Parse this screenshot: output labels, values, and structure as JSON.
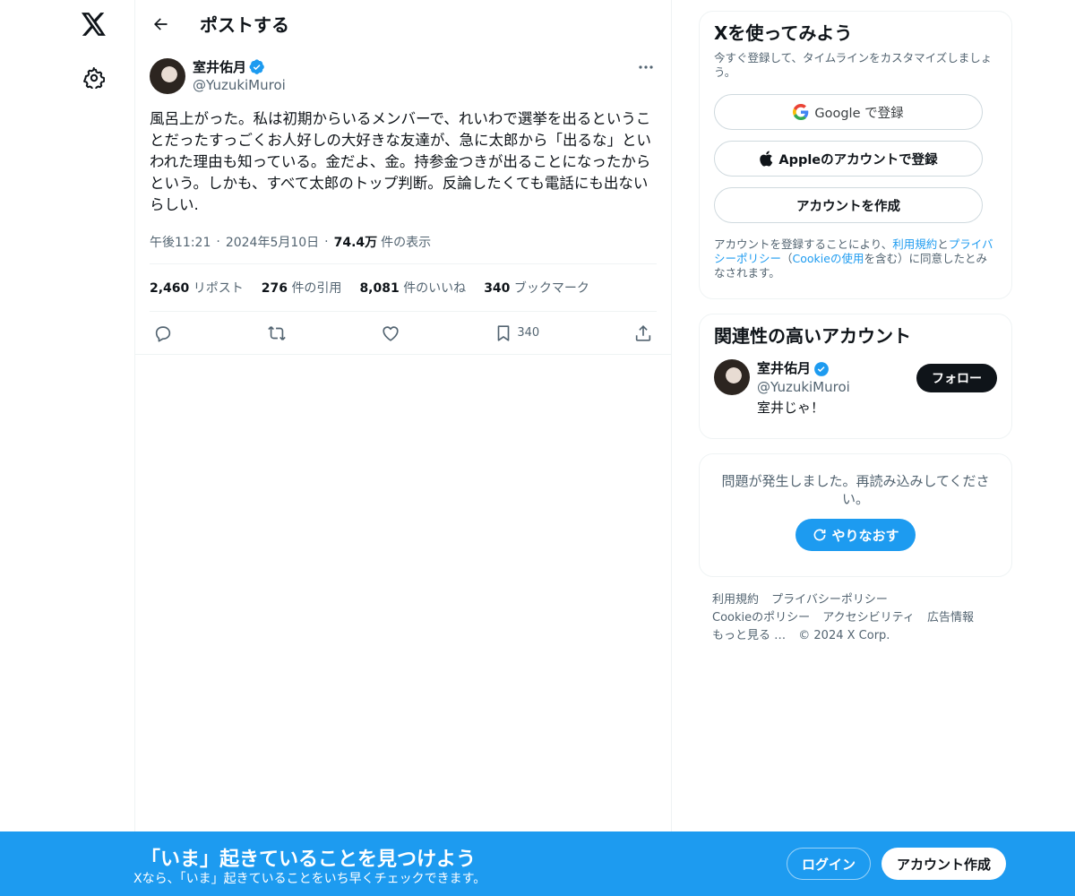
{
  "nav": {
    "logo_icon": "x-logo-icon",
    "settings_icon": "gear-icon"
  },
  "header": {
    "title": "ポストする"
  },
  "post": {
    "author_name": "室井佑月",
    "handle": "@YuzukiMuroi",
    "text": "風呂上がった。私は初期からいるメンバーで、れいわで選挙を出るということだったすっごくお人好しの大好きな友達が、急に太郎から「出るな」といわれた理由も知っている。金だよ、金。持参金つきが出ることになったからという。しかも、すべて太郎のトップ判断。反論したくても電話にも出ないらしい.",
    "time": "午後11:21",
    "date": "2024年5月10日",
    "views_count": "74.4万",
    "views_label": "件の表示",
    "separator": "·",
    "stats": {
      "reposts_count": "2,460",
      "reposts_label": "リポスト",
      "quotes_count": "276",
      "quotes_label": "件の引用",
      "likes_count": "8,081",
      "likes_label": "件のいいね",
      "bookmarks_count": "340",
      "bookmarks_label": "ブックマーク"
    },
    "actions": {
      "bookmark_count": "340"
    }
  },
  "signup": {
    "title": "Xを使ってみよう",
    "subtitle": "今すぐ登録して、タイムラインをカスタマイズしましょう。",
    "google_label": "Google で登録",
    "apple_label": "Appleのアカウントで登録",
    "create_label": "アカウントを作成",
    "legal_pre": "アカウントを登録することにより、",
    "legal_terms": "利用規約",
    "legal_and": "と",
    "legal_privacy": "プライバシーポリシー",
    "legal_paren_open": "（",
    "legal_cookie": "Cookieの使用",
    "legal_post": "を含む）に同意したとみなされます。"
  },
  "related": {
    "title": "関連性の高いアカウント",
    "name": "室井佑月",
    "handle": "@YuzukiMuroi",
    "bio": "室井じゃ！",
    "follow_label": "フォロー"
  },
  "error": {
    "message": "問題が発生しました。再読み込みしてください。",
    "retry_label": "やりなおす"
  },
  "footer": {
    "links": [
      "利用規約",
      "プライバシーポリシー",
      "Cookieのポリシー",
      "アクセシビリティ",
      "広告情報",
      "もっと見る …",
      "© 2024 X Corp."
    ]
  },
  "bottom_bar": {
    "title": "「いま」起きていることを見つけよう",
    "subtitle": "Xなら、「いま」起きていることをいち早くチェックできます。",
    "login_label": "ログイン",
    "create_label": "アカウント作成"
  },
  "colors": {
    "accent": "#1d9bf0",
    "text": "#0f1419",
    "muted": "#536471",
    "border": "#eff3f4"
  }
}
